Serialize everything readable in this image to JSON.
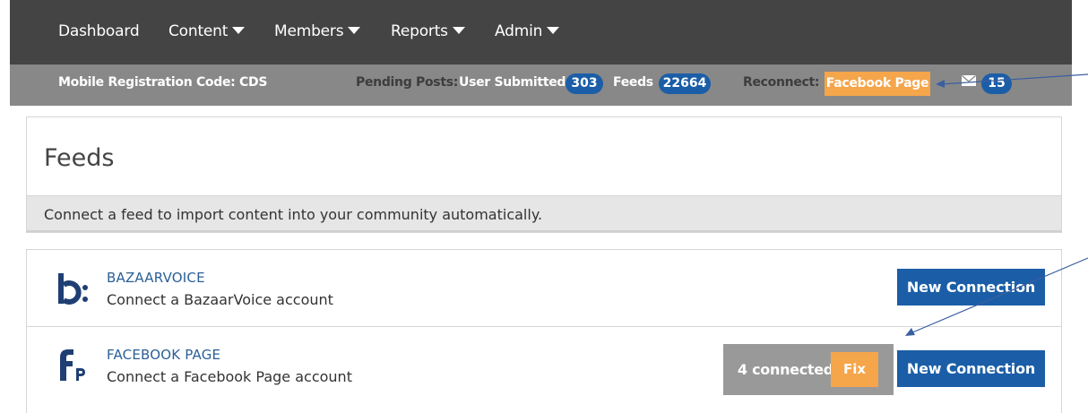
{
  "nav": {
    "items": [
      {
        "label": "Dashboard",
        "dropdown": false
      },
      {
        "label": "Content",
        "dropdown": true
      },
      {
        "label": "Members",
        "dropdown": true
      },
      {
        "label": "Reports",
        "dropdown": true
      },
      {
        "label": "Admin",
        "dropdown": true
      }
    ]
  },
  "subbar": {
    "mobile_code_label": "Mobile Registration Code: CDS",
    "pending_label": "Pending Posts:",
    "user_submitted_label": "User Submitted",
    "user_submitted_count": "303",
    "feeds_label": "Feeds",
    "feeds_count": "22664",
    "reconnect_label": "Reconnect:",
    "reconnect_button": "Facebook Page",
    "messages_count": "15"
  },
  "panel": {
    "title": "Feeds",
    "subtitle": "Connect a feed to import content into your community automatically."
  },
  "feeds": [
    {
      "name": "BAZAARVOICE",
      "description": "Connect a BazaarVoice account",
      "button": "New Connection"
    },
    {
      "name": "FACEBOOK PAGE",
      "description": "Connect a Facebook Page account",
      "connected_text": "4 connected",
      "fix_button": "Fix",
      "button": "New Connection"
    }
  ],
  "colors": {
    "nav_bg": "#444444",
    "subbar_bg": "#888888",
    "accent_blue": "#1b5ea7",
    "accent_orange": "#f5a54a",
    "link_blue": "#2b5f97"
  }
}
